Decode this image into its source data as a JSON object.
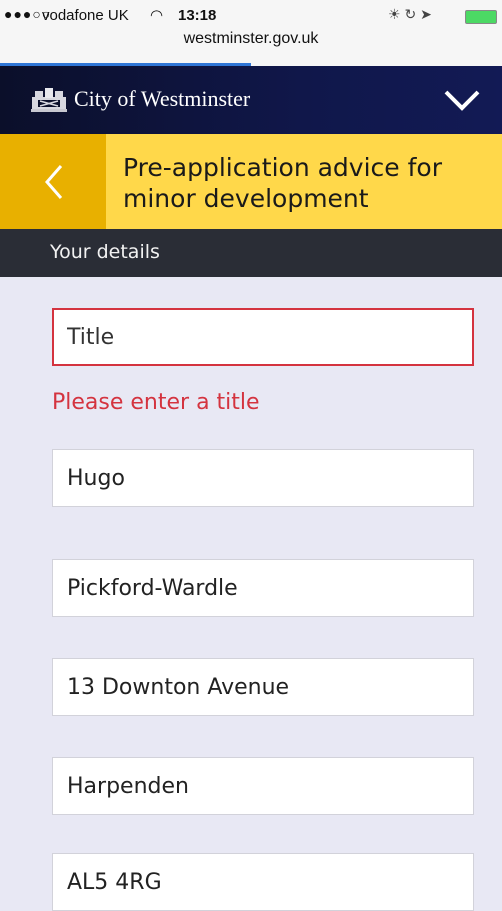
{
  "status_bar": {
    "signal": "●●●○○",
    "carrier": "vodafone UK",
    "time": "13:18",
    "url": "westminster.gov.uk",
    "load_progress": 0.5
  },
  "header": {
    "brand": "City of Westminster",
    "crest_icon": "westminster-crest-icon",
    "menu_icon": "chevron-down-icon"
  },
  "title_bar": {
    "back_icon": "chevron-left-icon",
    "title": "Pre-application advice for minor development"
  },
  "section": {
    "label": "Your details"
  },
  "form": {
    "title_field": {
      "placeholder": "Title",
      "value": ""
    },
    "title_error": "Please enter a title",
    "first_name": {
      "value": "Hugo"
    },
    "last_name": {
      "value": "Pickford-Wardle"
    },
    "address_line1": {
      "value": "13 Downton Avenue"
    },
    "town": {
      "value": "Harpenden"
    },
    "postcode": {
      "value": "AL5 4RG"
    }
  },
  "colors": {
    "header_bg": "#0b0f2a",
    "title_bar_bg": "#ffd84a",
    "back_button_bg": "#e8b000",
    "section_bar_bg": "#2a2d36",
    "error": "#d4333f",
    "page_bg": "#e8e8f4"
  }
}
